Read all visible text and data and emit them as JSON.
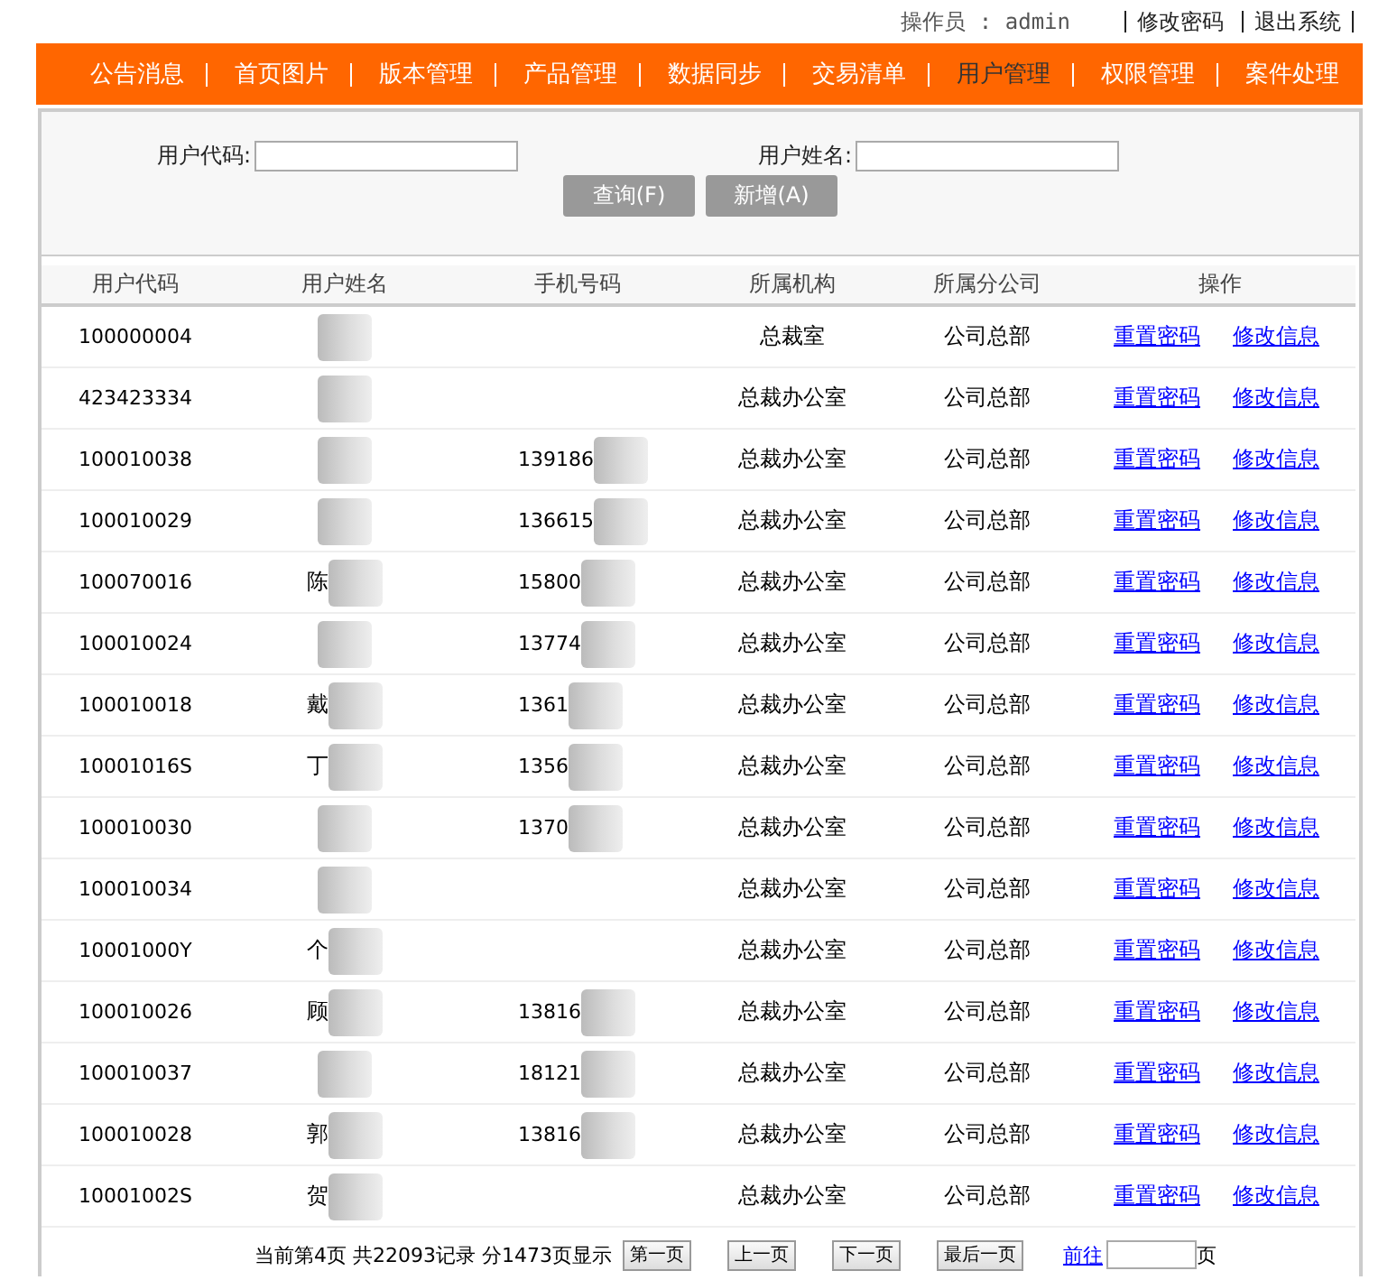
{
  "top_bar": {
    "operator_label": "操作员 : admin",
    "links": [
      "修改密码",
      "退出系统"
    ]
  },
  "nav": [
    {
      "label": "公告消息",
      "selected": false
    },
    {
      "label": "首页图片",
      "selected": false
    },
    {
      "label": "版本管理",
      "selected": false
    },
    {
      "label": "产品管理",
      "selected": false
    },
    {
      "label": "数据同步",
      "selected": false
    },
    {
      "label": "交易清单",
      "selected": false
    },
    {
      "label": "用户管理",
      "selected": true
    },
    {
      "label": "权限管理",
      "selected": false
    },
    {
      "label": "案件处理",
      "selected": false
    }
  ],
  "search": {
    "fields": [
      {
        "label": "用户代码:"
      },
      {
        "label": "用户姓名:"
      }
    ],
    "buttons": [
      "查询(F)",
      "新增(A)"
    ]
  },
  "table": {
    "columns": [
      "用户代码",
      "用户姓名",
      "手机号码",
      "所属机构",
      "所属分公司",
      "操作"
    ],
    "rows": [
      {
        "code": "100000004",
        "name": {
          "redacted": true
        },
        "org": "总裁室",
        "branch": "公司总部",
        "actions": [
          "重置密码",
          "修改信息"
        ]
      },
      {
        "code": "423423334",
        "name": {
          "redacted": true
        },
        "org": "总裁办公室",
        "branch": "公司总部",
        "actions": [
          "重置密码",
          "修改信息"
        ]
      },
      {
        "code": "100010038",
        "name": {
          "redacted": true
        },
        "phone": {
          "text": "139186",
          "redacted": true
        },
        "org": "总裁办公室",
        "branch": "公司总部",
        "actions": [
          "重置密码",
          "修改信息"
        ]
      },
      {
        "code": "100010029",
        "name": {
          "redacted": true
        },
        "phone": {
          "text": "136615",
          "redacted": true
        },
        "org": "总裁办公室",
        "branch": "公司总部",
        "actions": [
          "重置密码",
          "修改信息"
        ]
      },
      {
        "code": "100070016",
        "name": {
          "text": "陈",
          "redacted": true
        },
        "phone": {
          "text": "15800",
          "redacted": true
        },
        "org": "总裁办公室",
        "branch": "公司总部",
        "actions": [
          "重置密码",
          "修改信息"
        ]
      },
      {
        "code": "100010024",
        "name": {
          "redacted": true
        },
        "phone": {
          "text": "13774",
          "redacted": true
        },
        "org": "总裁办公室",
        "branch": "公司总部",
        "actions": [
          "重置密码",
          "修改信息"
        ]
      },
      {
        "code": "100010018",
        "name": {
          "text": "戴",
          "redacted": true
        },
        "phone": {
          "text": "1361",
          "redacted": true
        },
        "org": "总裁办公室",
        "branch": "公司总部",
        "actions": [
          "重置密码",
          "修改信息"
        ]
      },
      {
        "code": "10001016S",
        "name": {
          "text": "丁",
          "redacted": true
        },
        "phone": {
          "text": "1356",
          "redacted": true
        },
        "org": "总裁办公室",
        "branch": "公司总部",
        "actions": [
          "重置密码",
          "修改信息"
        ]
      },
      {
        "code": "100010030",
        "name": {
          "redacted": true
        },
        "phone": {
          "text": "1370",
          "redacted": true
        },
        "org": "总裁办公室",
        "branch": "公司总部",
        "actions": [
          "重置密码",
          "修改信息"
        ]
      },
      {
        "code": "100010034",
        "name": {
          "redacted": true
        },
        "org": "总裁办公室",
        "branch": "公司总部",
        "actions": [
          "重置密码",
          "修改信息"
        ]
      },
      {
        "code": "10001000Y",
        "name": {
          "text": "个",
          "redacted": true
        },
        "org": "总裁办公室",
        "branch": "公司总部",
        "actions": [
          "重置密码",
          "修改信息"
        ]
      },
      {
        "code": "100010026",
        "name": {
          "text": "顾",
          "redacted": true
        },
        "phone": {
          "text": "13816",
          "redacted": true
        },
        "org": "总裁办公室",
        "branch": "公司总部",
        "actions": [
          "重置密码",
          "修改信息"
        ]
      },
      {
        "code": "100010037",
        "name": {
          "redacted": true
        },
        "phone": {
          "text": "18121",
          "redacted": true
        },
        "org": "总裁办公室",
        "branch": "公司总部",
        "actions": [
          "重置密码",
          "修改信息"
        ]
      },
      {
        "code": "100010028",
        "name": {
          "text": "郭",
          "redacted": true
        },
        "phone": {
          "text": "13816",
          "redacted": true
        },
        "org": "总裁办公室",
        "branch": "公司总部",
        "actions": [
          "重置密码",
          "修改信息"
        ]
      },
      {
        "code": "10001002S",
        "name": {
          "text": "贺",
          "redacted": true
        },
        "org": "总裁办公室",
        "branch": "公司总部",
        "actions": [
          "重置密码",
          "修改信息"
        ]
      }
    ]
  },
  "pager": {
    "summary": "当前第4页 共22093记录 分1473页显示",
    "buttons": [
      "第一页",
      "上一页",
      "下一页",
      "最后一页"
    ],
    "goto_link": "前往",
    "page_suffix": "页"
  }
}
